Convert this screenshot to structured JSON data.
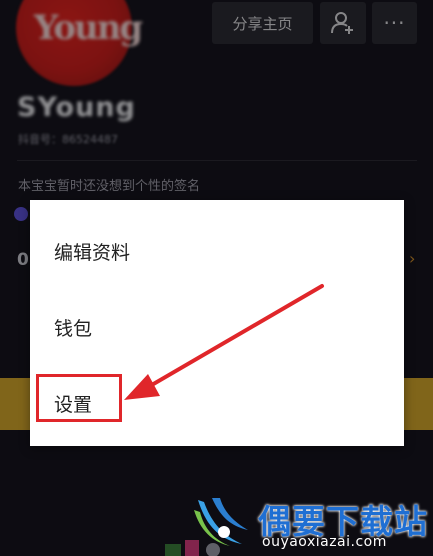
{
  "profile": {
    "avatar_text": "Young",
    "username": "SYoung",
    "user_id": "抖音号：86524487",
    "signature": "本宝宝暂时还没想到个性的签名",
    "stat_digit": "0"
  },
  "header": {
    "share_label": "分享主页",
    "add_friend_icon": "add-user-icon",
    "more_label": "···"
  },
  "menu": {
    "items": [
      {
        "label": "编辑资料"
      },
      {
        "label": "钱包"
      },
      {
        "label": "设置"
      }
    ],
    "highlighted_item": "设置"
  },
  "annotation": {
    "arrow_color": "#e0262a",
    "highlight_color": "#e0262a"
  },
  "watermark": {
    "title": "偶要下载站",
    "url": "ouyaoxiazai.com",
    "color": "#1f6fd3"
  },
  "colors": {
    "background": "#15141d",
    "accent_yellow": "#cfa32a",
    "accent_purple": "#5b4fd6"
  }
}
